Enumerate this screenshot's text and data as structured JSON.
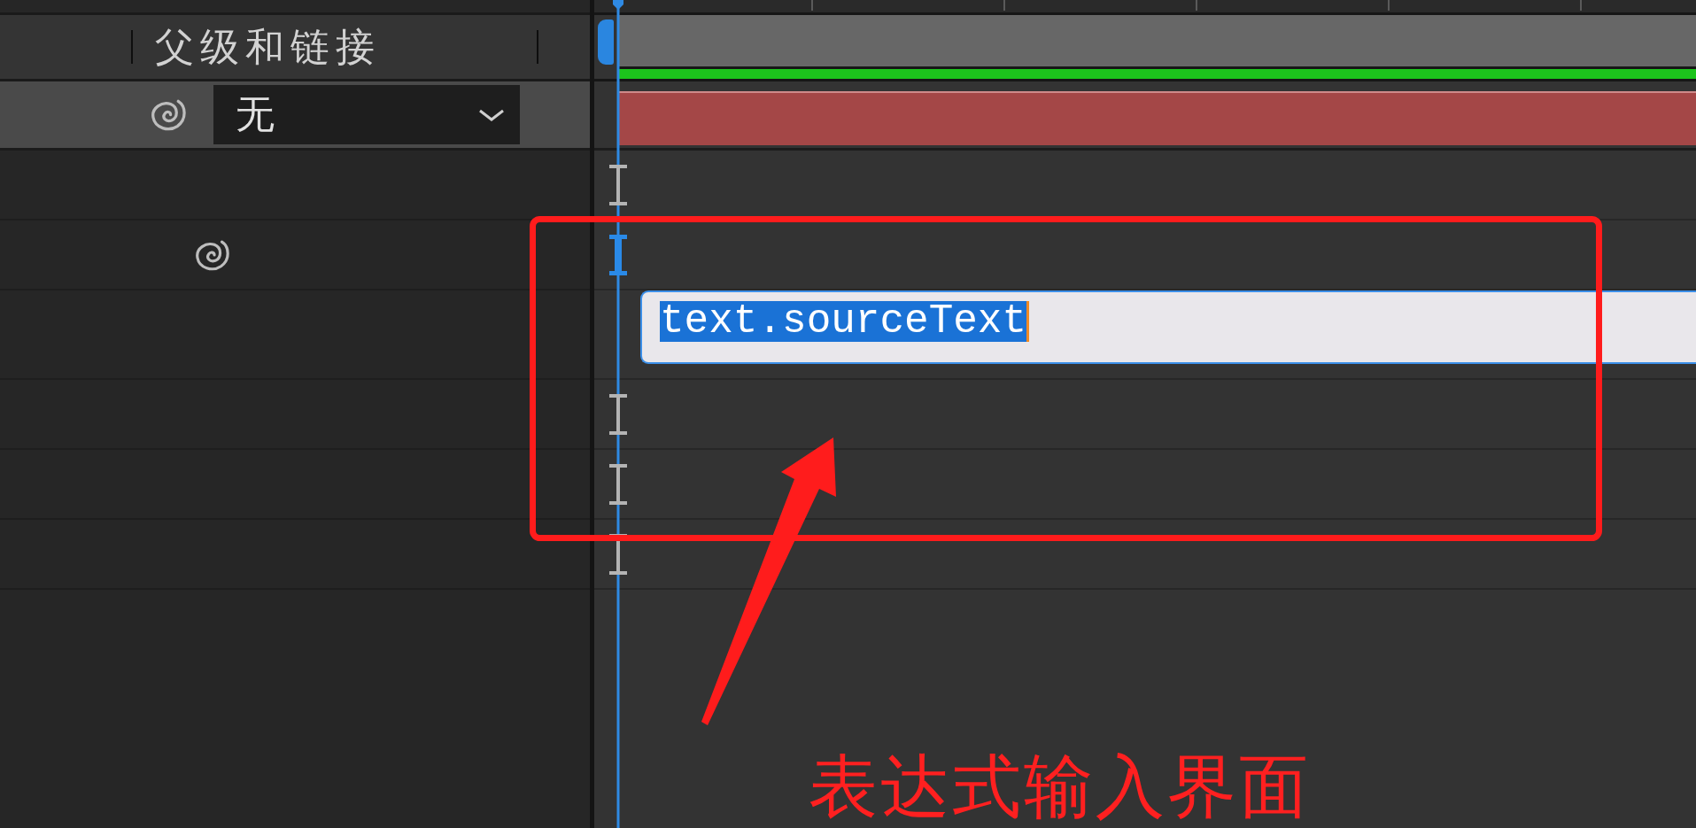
{
  "header": {
    "column_title": "父级和链接"
  },
  "layer": {
    "pick_whip": true,
    "parent": {
      "value": "无"
    }
  },
  "property_rows": [
    {
      "kind": "marker",
      "pick_whip": false,
      "selected": false
    },
    {
      "kind": "marker",
      "pick_whip": true,
      "selected": true
    },
    {
      "kind": "expression",
      "expression": "text.sourceText",
      "selected": true
    },
    {
      "kind": "marker",
      "pick_whip": false,
      "selected": false
    },
    {
      "kind": "marker",
      "pick_whip": false,
      "selected": false
    },
    {
      "kind": "marker",
      "pick_whip": false,
      "selected": false
    }
  ],
  "annotation": {
    "label": "表达式输入界面"
  }
}
